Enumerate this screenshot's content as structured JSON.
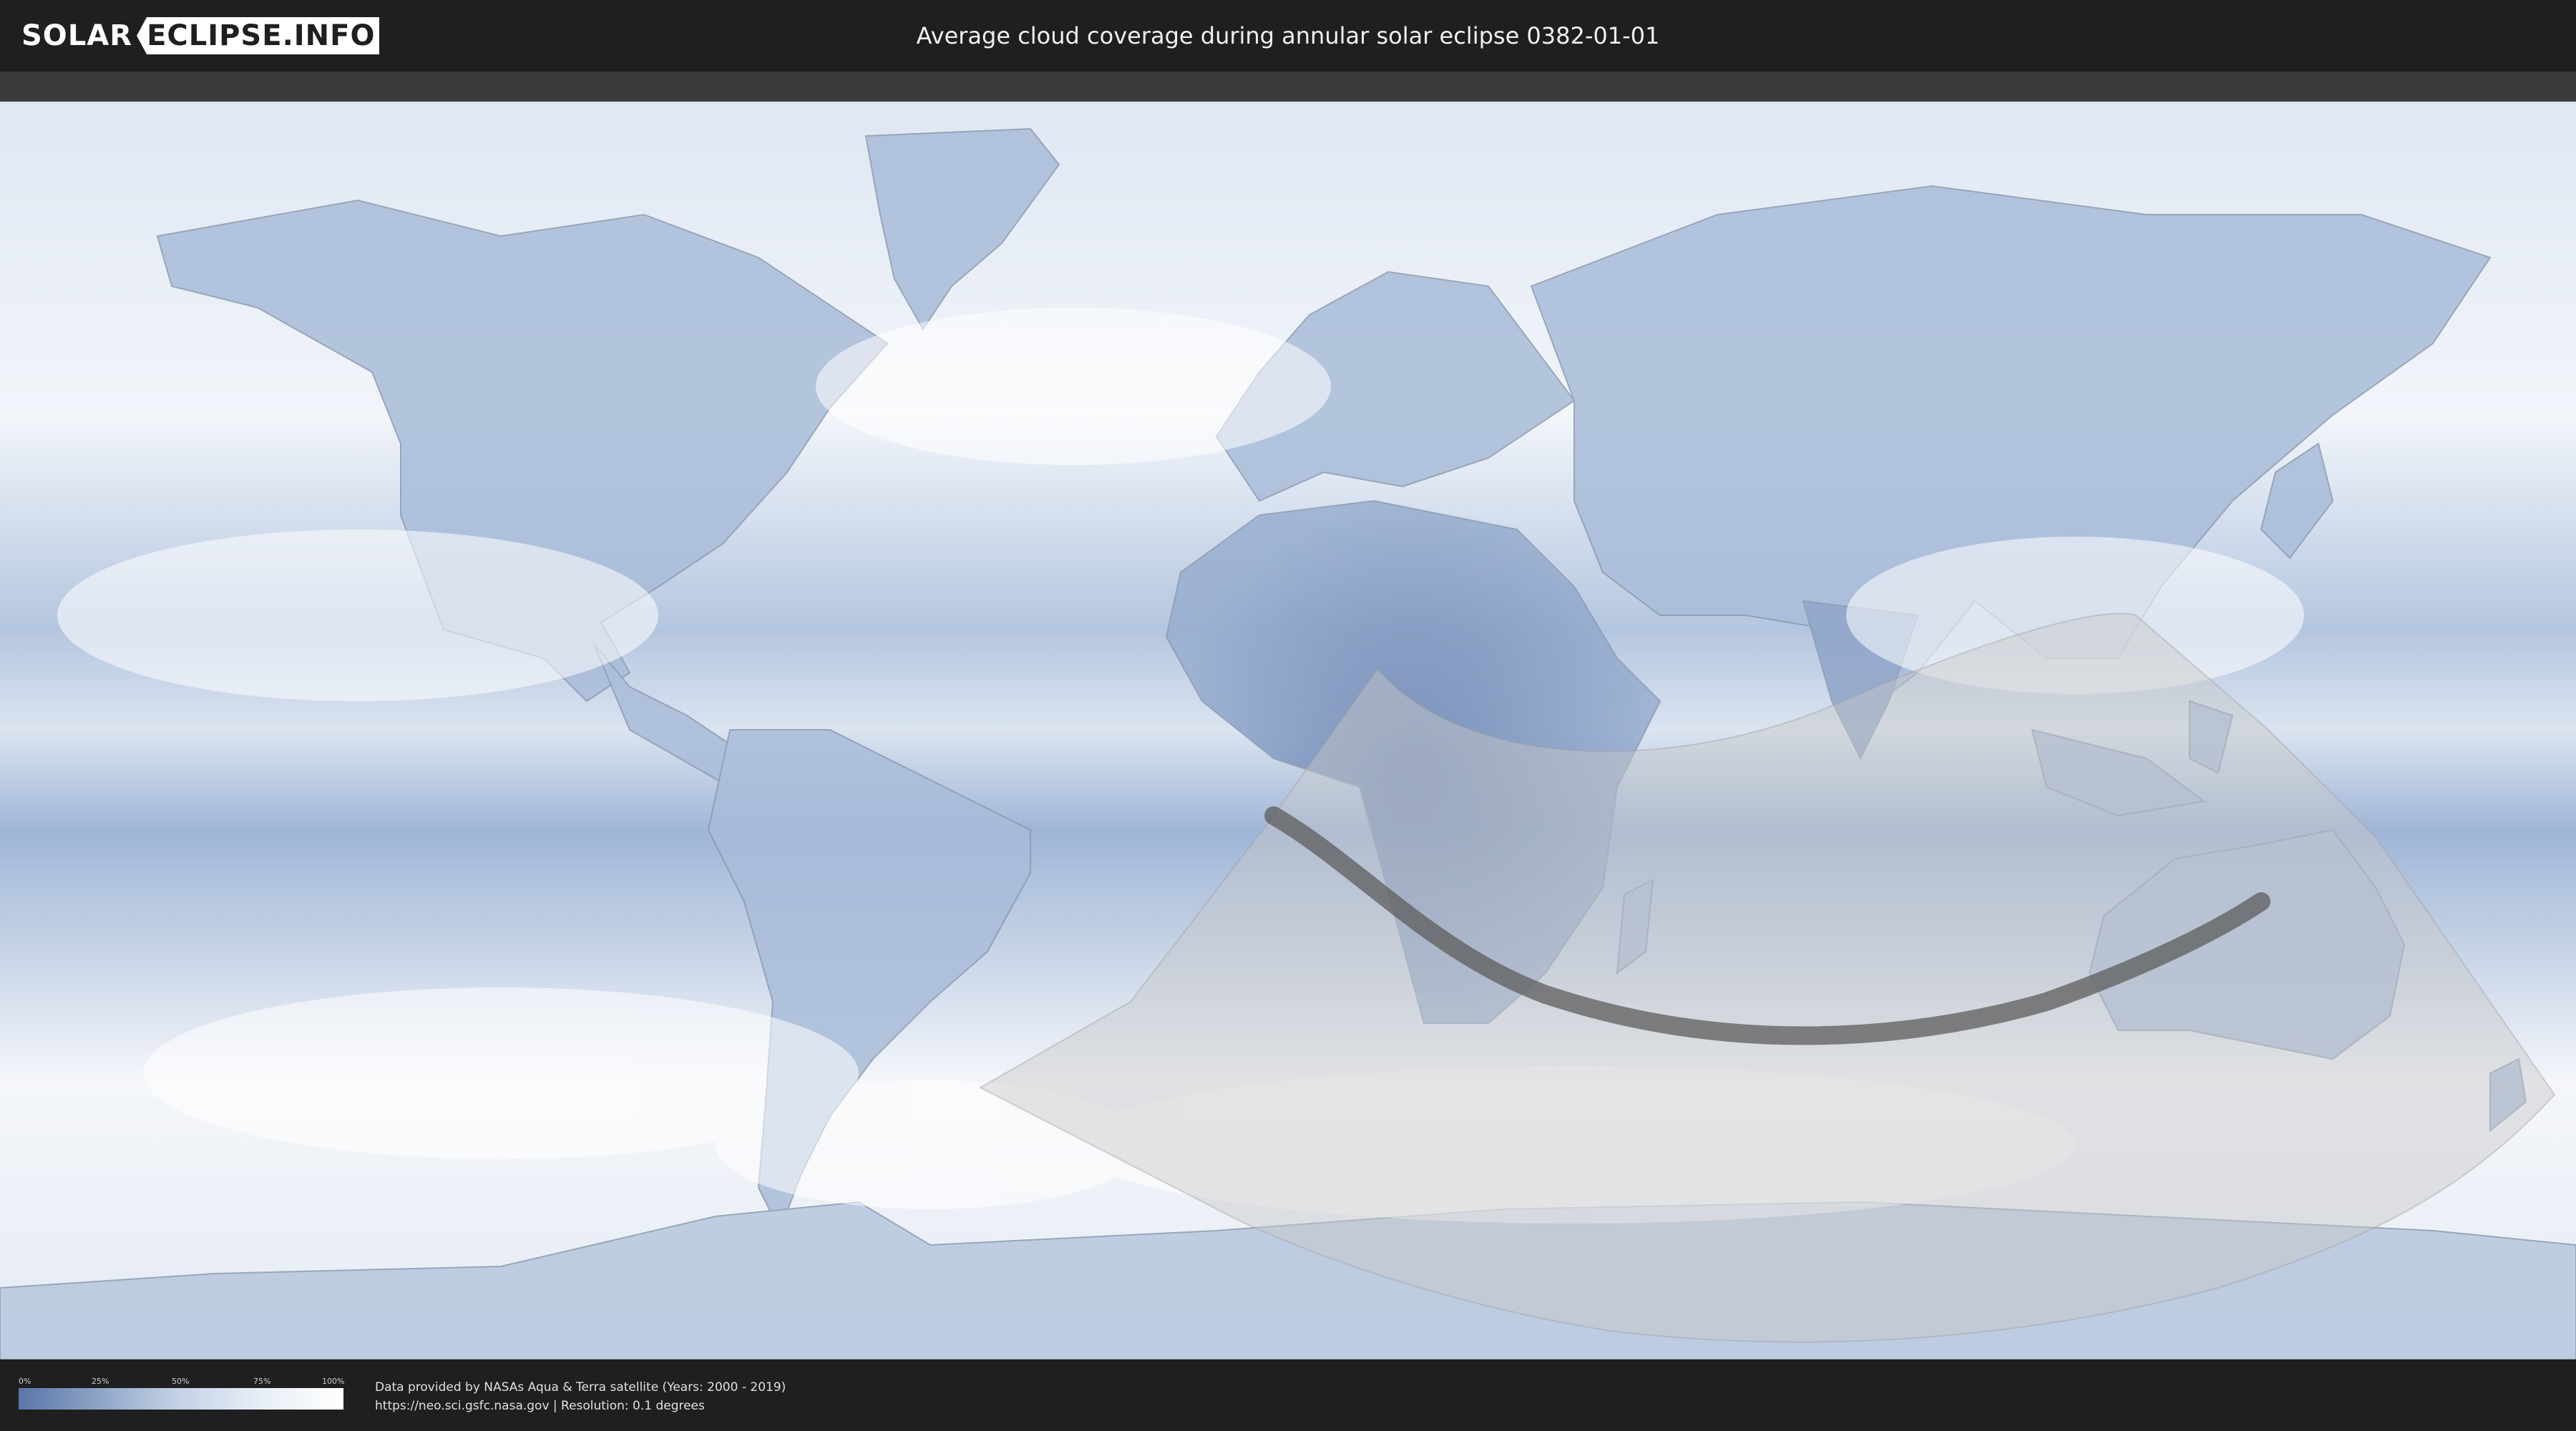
{
  "header": {
    "logo_left": "SOLAR",
    "logo_right": "ECLIPSE.INFO",
    "title": "Average cloud coverage during annular solar eclipse 0382-01-01"
  },
  "map": {
    "type": "cloud-coverage-world-map",
    "colors": {
      "clear": "#5a76a8",
      "cloudy": "#ffffff",
      "eclipse_zone": "#d0d0d0",
      "central_path": "#5c5c5c"
    }
  },
  "legend": {
    "ticks": [
      "0%",
      "25%",
      "50%",
      "75%",
      "100%"
    ]
  },
  "credits": {
    "line1": "Data provided by NASAs Aqua & Terra satellite (Years: 2000 - 2019)",
    "line2": "https://neo.sci.gsfc.nasa.gov | Resolution: 0.1 degrees"
  }
}
